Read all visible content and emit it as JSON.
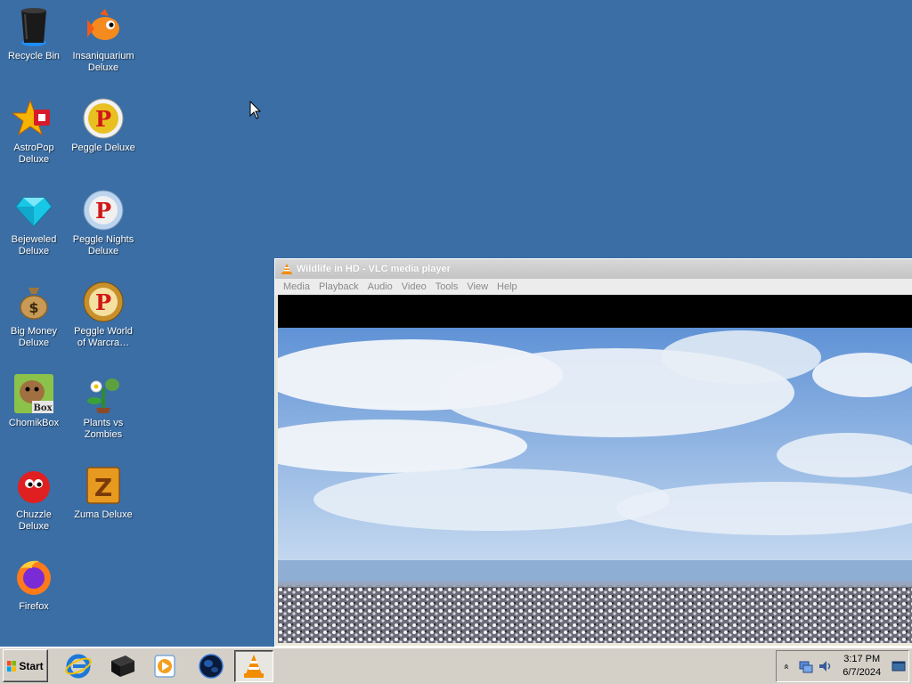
{
  "desktop": {
    "icons": [
      {
        "label": "Recycle Bin",
        "icon": "recycle-bin-icon"
      },
      {
        "label": "Insaniquarium Deluxe",
        "icon": "goldfish-icon"
      },
      {
        "label": "AstroPop Deluxe",
        "icon": "astropop-icon"
      },
      {
        "label": "Peggle Deluxe",
        "icon": "peggle-icon"
      },
      {
        "label": "Bejeweled Deluxe",
        "icon": "gem-icon"
      },
      {
        "label": "Peggle Nights Deluxe",
        "icon": "peggle-nights-icon"
      },
      {
        "label": "Big Money Deluxe",
        "icon": "money-bag-icon"
      },
      {
        "label": "Peggle World of Warcra…",
        "icon": "peggle-wow-icon"
      },
      {
        "label": "ChomikBox",
        "icon": "chomikbox-icon"
      },
      {
        "label": "Plants vs Zombies",
        "icon": "plants-vs-zombies-icon"
      },
      {
        "label": "Chuzzle Deluxe",
        "icon": "chuzzle-icon"
      },
      {
        "label": "Zuma Deluxe",
        "icon": "zuma-icon"
      },
      {
        "label": "Firefox",
        "icon": "firefox-icon"
      }
    ],
    "background_color": "#3a6ea5"
  },
  "vlc": {
    "title": "Wildlife in HD - VLC media player",
    "menu": [
      "Media",
      "Playback",
      "Audio",
      "Video",
      "Tools",
      "View",
      "Help"
    ]
  },
  "taskbar": {
    "start_label": "Start",
    "quick_launch": [
      {
        "icon": "internet-explorer-icon"
      },
      {
        "icon": "black-box-icon"
      },
      {
        "icon": "media-player-icon"
      },
      {
        "icon": "globe-icon"
      },
      {
        "icon": "vlc-cone-icon",
        "active": true
      }
    ],
    "tray": {
      "expand_glyph": "»",
      "time": "3:17 PM",
      "date": "6/7/2024"
    }
  }
}
